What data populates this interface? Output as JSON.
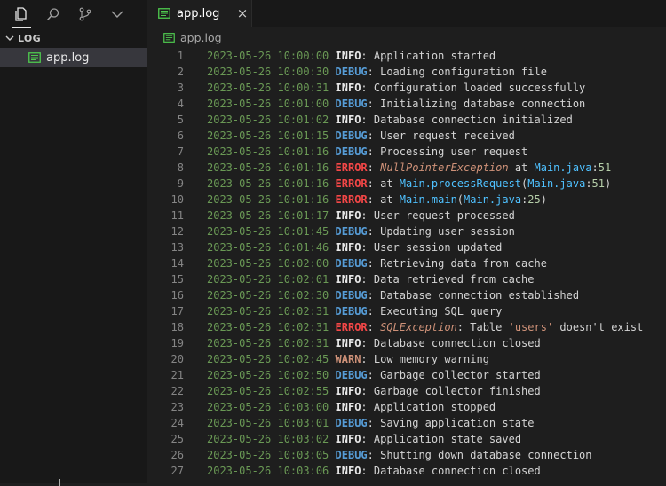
{
  "activity_bar": {
    "icons": [
      "files-icon",
      "search-icon",
      "source-control-icon",
      "chevron-down-icon"
    ]
  },
  "explorer": {
    "section_label": "LOG",
    "files": [
      {
        "label": "app.log",
        "selected": true
      }
    ]
  },
  "tab": {
    "label": "app.log",
    "close_glyph": "×"
  },
  "breadcrumb": {
    "label": "app.log"
  },
  "log_lines": [
    {
      "n": "1",
      "ts": "2023-05-26 10:00:00",
      "level": "INFO",
      "segs": [
        {
          "t": ": Application started",
          "c": "msg"
        }
      ]
    },
    {
      "n": "2",
      "ts": "2023-05-26 10:00:30",
      "level": "DEBUG",
      "segs": [
        {
          "t": ": Loading configuration file",
          "c": "msg"
        }
      ]
    },
    {
      "n": "3",
      "ts": "2023-05-26 10:00:31",
      "level": "INFO",
      "segs": [
        {
          "t": ": Configuration loaded successfully",
          "c": "msg"
        }
      ]
    },
    {
      "n": "4",
      "ts": "2023-05-26 10:01:00",
      "level": "DEBUG",
      "segs": [
        {
          "t": ": Initializing database connection",
          "c": "msg"
        }
      ]
    },
    {
      "n": "5",
      "ts": "2023-05-26 10:01:02",
      "level": "INFO",
      "segs": [
        {
          "t": ": Database connection initialized",
          "c": "msg"
        }
      ]
    },
    {
      "n": "6",
      "ts": "2023-05-26 10:01:15",
      "level": "DEBUG",
      "segs": [
        {
          "t": ": User request received",
          "c": "msg"
        }
      ]
    },
    {
      "n": "7",
      "ts": "2023-05-26 10:01:16",
      "level": "DEBUG",
      "segs": [
        {
          "t": ": Processing user request",
          "c": "msg"
        }
      ]
    },
    {
      "n": "8",
      "ts": "2023-05-26 10:01:16",
      "level": "ERROR",
      "segs": [
        {
          "t": ": ",
          "c": "msg"
        },
        {
          "t": "NullPointerException",
          "c": "exc"
        },
        {
          "t": " at ",
          "c": "msg"
        },
        {
          "t": "Main.java",
          "c": "ref"
        },
        {
          "t": ":",
          "c": "msg"
        },
        {
          "t": "51",
          "c": "num"
        }
      ]
    },
    {
      "n": "9",
      "ts": "2023-05-26 10:01:16",
      "level": "ERROR",
      "segs": [
        {
          "t": ": at ",
          "c": "msg"
        },
        {
          "t": "Main.processRequest",
          "c": "ref"
        },
        {
          "t": "(",
          "c": "msg"
        },
        {
          "t": "Main.java",
          "c": "ref"
        },
        {
          "t": ":",
          "c": "msg"
        },
        {
          "t": "51",
          "c": "num"
        },
        {
          "t": ")",
          "c": "msg"
        }
      ]
    },
    {
      "n": "10",
      "ts": "2023-05-26 10:01:16",
      "level": "ERROR",
      "segs": [
        {
          "t": ": at ",
          "c": "msg"
        },
        {
          "t": "Main.main",
          "c": "ref"
        },
        {
          "t": "(",
          "c": "msg"
        },
        {
          "t": "Main.java",
          "c": "ref"
        },
        {
          "t": ":",
          "c": "msg"
        },
        {
          "t": "25",
          "c": "num"
        },
        {
          "t": ")",
          "c": "msg"
        }
      ]
    },
    {
      "n": "11",
      "ts": "2023-05-26 10:01:17",
      "level": "INFO",
      "segs": [
        {
          "t": ": User request processed",
          "c": "msg"
        }
      ]
    },
    {
      "n": "12",
      "ts": "2023-05-26 10:01:45",
      "level": "DEBUG",
      "segs": [
        {
          "t": ": Updating user session",
          "c": "msg"
        }
      ]
    },
    {
      "n": "13",
      "ts": "2023-05-26 10:01:46",
      "level": "INFO",
      "segs": [
        {
          "t": ": User session updated",
          "c": "msg"
        }
      ]
    },
    {
      "n": "14",
      "ts": "2023-05-26 10:02:00",
      "level": "DEBUG",
      "segs": [
        {
          "t": ": Retrieving data from cache",
          "c": "msg"
        }
      ]
    },
    {
      "n": "15",
      "ts": "2023-05-26 10:02:01",
      "level": "INFO",
      "segs": [
        {
          "t": ": Data retrieved from cache",
          "c": "msg"
        }
      ]
    },
    {
      "n": "16",
      "ts": "2023-05-26 10:02:30",
      "level": "DEBUG",
      "segs": [
        {
          "t": ": Database connection established",
          "c": "msg"
        }
      ]
    },
    {
      "n": "17",
      "ts": "2023-05-26 10:02:31",
      "level": "DEBUG",
      "segs": [
        {
          "t": ": Executing SQL query",
          "c": "msg"
        }
      ]
    },
    {
      "n": "18",
      "ts": "2023-05-26 10:02:31",
      "level": "ERROR",
      "segs": [
        {
          "t": ": ",
          "c": "msg"
        },
        {
          "t": "SQLException",
          "c": "exc"
        },
        {
          "t": ": Table ",
          "c": "msg"
        },
        {
          "t": "'users'",
          "c": "str"
        },
        {
          "t": " doesn't exist",
          "c": "msg"
        }
      ]
    },
    {
      "n": "19",
      "ts": "2023-05-26 10:02:31",
      "level": "INFO",
      "segs": [
        {
          "t": ": Database connection closed",
          "c": "msg"
        }
      ]
    },
    {
      "n": "20",
      "ts": "2023-05-26 10:02:45",
      "level": "WARN",
      "segs": [
        {
          "t": ": Low memory warning",
          "c": "msg"
        }
      ]
    },
    {
      "n": "21",
      "ts": "2023-05-26 10:02:50",
      "level": "DEBUG",
      "segs": [
        {
          "t": ": Garbage collector started",
          "c": "msg"
        }
      ]
    },
    {
      "n": "22",
      "ts": "2023-05-26 10:02:55",
      "level": "INFO",
      "segs": [
        {
          "t": ": Garbage collector finished",
          "c": "msg"
        }
      ]
    },
    {
      "n": "23",
      "ts": "2023-05-26 10:03:00",
      "level": "INFO",
      "segs": [
        {
          "t": ": Application stopped",
          "c": "msg"
        }
      ]
    },
    {
      "n": "24",
      "ts": "2023-05-26 10:03:01",
      "level": "DEBUG",
      "segs": [
        {
          "t": ": Saving application state",
          "c": "msg"
        }
      ]
    },
    {
      "n": "25",
      "ts": "2023-05-26 10:03:02",
      "level": "INFO",
      "segs": [
        {
          "t": ": Application state saved",
          "c": "msg"
        }
      ]
    },
    {
      "n": "26",
      "ts": "2023-05-26 10:03:05",
      "level": "DEBUG",
      "segs": [
        {
          "t": ": Shutting down database connection",
          "c": "msg"
        }
      ]
    },
    {
      "n": "27",
      "ts": "2023-05-26 10:03:06",
      "level": "INFO",
      "segs": [
        {
          "t": ": Database connection closed",
          "c": "msg"
        }
      ]
    }
  ],
  "colors": {
    "timestamp": "#6a9955",
    "info": "#e8e8e8",
    "debug": "#569cd6",
    "error": "#f44747",
    "warn": "#ce9178",
    "exception": "#ce9178",
    "reference": "#4fc1ff",
    "number": "#b5cea8",
    "log_file_icon": "#4ec94e"
  }
}
